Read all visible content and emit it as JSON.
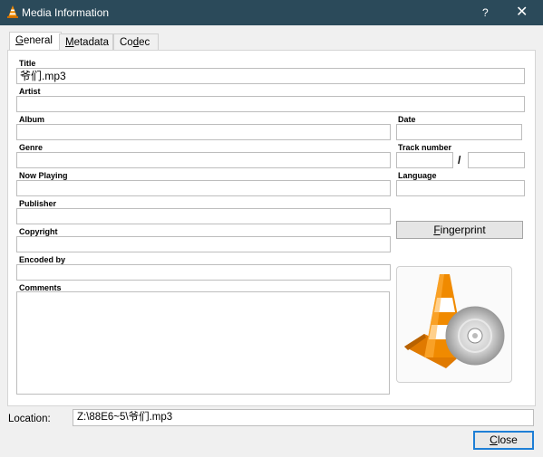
{
  "window": {
    "title": "Media Information",
    "help_label": "?",
    "close_label": "✕"
  },
  "tabs": [
    {
      "label": "General",
      "accel_first": "G",
      "rest": "eneral"
    },
    {
      "label": "Metadata",
      "accel_first": "M",
      "rest": "etadata"
    },
    {
      "label": "Codec",
      "pre": "Co",
      "accel": "d",
      "post": "ec"
    }
  ],
  "fields": {
    "title": {
      "label": "Title",
      "value": "爷们.mp3"
    },
    "artist": {
      "label": "Artist",
      "value": ""
    },
    "album": {
      "label": "Album",
      "value": ""
    },
    "date": {
      "label": "Date",
      "value": ""
    },
    "genre": {
      "label": "Genre",
      "value": ""
    },
    "track_number": {
      "label": "Track number",
      "value": "",
      "total": "",
      "separator": "/"
    },
    "now_playing": {
      "label": "Now Playing",
      "value": ""
    },
    "language": {
      "label": "Language",
      "value": ""
    },
    "publisher": {
      "label": "Publisher",
      "value": ""
    },
    "copyright": {
      "label": "Copyright",
      "value": ""
    },
    "encoded_by": {
      "label": "Encoded by",
      "value": ""
    },
    "comments": {
      "label": "Comments",
      "value": ""
    }
  },
  "buttons": {
    "fingerprint": {
      "label": "Fingerprint",
      "accel": "F",
      "rest": "ingerprint"
    },
    "close": {
      "label": "Close",
      "accel": "C",
      "rest": "lose"
    }
  },
  "location": {
    "label": "Location:",
    "value": "Z:\\88E6~5\\爷们.mp3"
  },
  "icons": {
    "app": "vlc-cone-icon",
    "artwork": "vlc-cone-with-disc-icon"
  },
  "colors": {
    "titlebar": "#2b4a5a",
    "cone_orange": "#f08a00",
    "focus_border": "#1f7fd6"
  }
}
